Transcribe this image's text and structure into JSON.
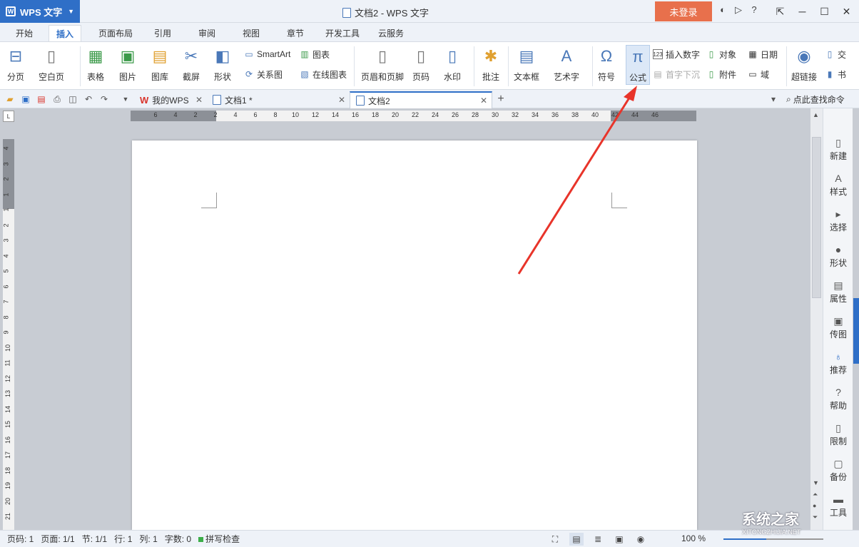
{
  "app": {
    "name": "WPS 文字",
    "window_title": "文档2 - WPS 文字",
    "login": "未登录"
  },
  "menu_tabs": [
    "开始",
    "插入",
    "页面布局",
    "引用",
    "审阅",
    "视图",
    "章节",
    "开发工具",
    "云服务"
  ],
  "active_menu_tab": "插入",
  "ribbon": {
    "page_break": "分页",
    "blank_page": "空白页",
    "table": "表格",
    "picture": "图片",
    "gallery": "图库",
    "screenshot": "截屏",
    "shape": "形状",
    "smartart": "SmartArt",
    "chart": "图表",
    "relation": "关系图",
    "online_chart": "在线图表",
    "header_footer": "页眉和页脚",
    "page_number": "页码",
    "watermark": "水印",
    "comment": "批注",
    "textbox": "文本框",
    "wordart": "艺术字",
    "symbol": "符号",
    "formula": "公式",
    "insert_number": "插入数字",
    "dropcap": "首字下沉",
    "object": "对象",
    "attachment": "附件",
    "date": "日期",
    "field": "域",
    "hyperlink": "超链接",
    "cross_ref": "交",
    "bookmark": "书"
  },
  "doc_tabs": [
    {
      "label": "我的WPS"
    },
    {
      "label": "文档1 *"
    },
    {
      "label": "文档2"
    }
  ],
  "search_command": "点此查找命令",
  "ruler_h": [
    "6",
    "4",
    "2",
    "2",
    "4",
    "6",
    "8",
    "10",
    "12",
    "14",
    "16",
    "18",
    "20",
    "22",
    "24",
    "26",
    "28",
    "30",
    "32",
    "34",
    "36",
    "38",
    "40",
    "42",
    "44",
    "46"
  ],
  "ruler_v": [
    "4",
    "3",
    "2",
    "1",
    "1",
    "2",
    "3",
    "4",
    "5",
    "6",
    "7",
    "8",
    "9",
    "10",
    "11",
    "12",
    "13",
    "14",
    "15",
    "16",
    "17",
    "18",
    "19",
    "20",
    "21"
  ],
  "right_panel": [
    "新建",
    "样式",
    "选择",
    "形状",
    "属性",
    "传图",
    "推荐",
    "帮助",
    "限制",
    "备份",
    "工具"
  ],
  "status": {
    "page_code": "页码: 1",
    "page": "页面: 1/1",
    "section": "节: 1/1",
    "row": "行: 1",
    "col": "列: 1",
    "word_count": "字数: 0",
    "spell_check": "拼写检查",
    "zoom": "100 %"
  },
  "watermark": {
    "brand": "系统之家",
    "url": "XITONGZHIJIA.NET"
  }
}
